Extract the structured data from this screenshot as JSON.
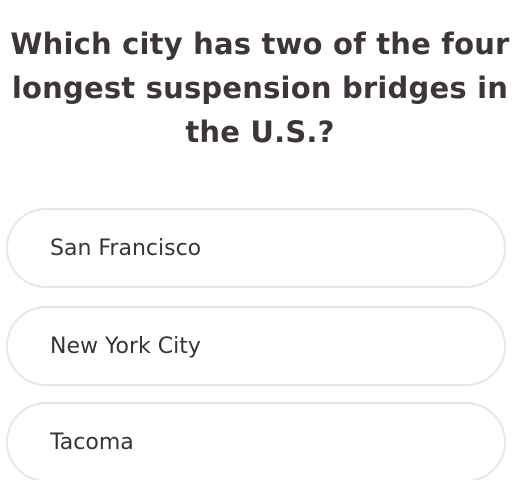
{
  "question": {
    "text": "Which city has two of the four longest suspension bridges in the U.S.?"
  },
  "options": [
    {
      "label": "San Francisco"
    },
    {
      "label": "New York City"
    },
    {
      "label": "Tacoma"
    }
  ],
  "colors": {
    "text": "#3d3538",
    "option_border": "#e6e6e6",
    "background": "#ffffff"
  }
}
